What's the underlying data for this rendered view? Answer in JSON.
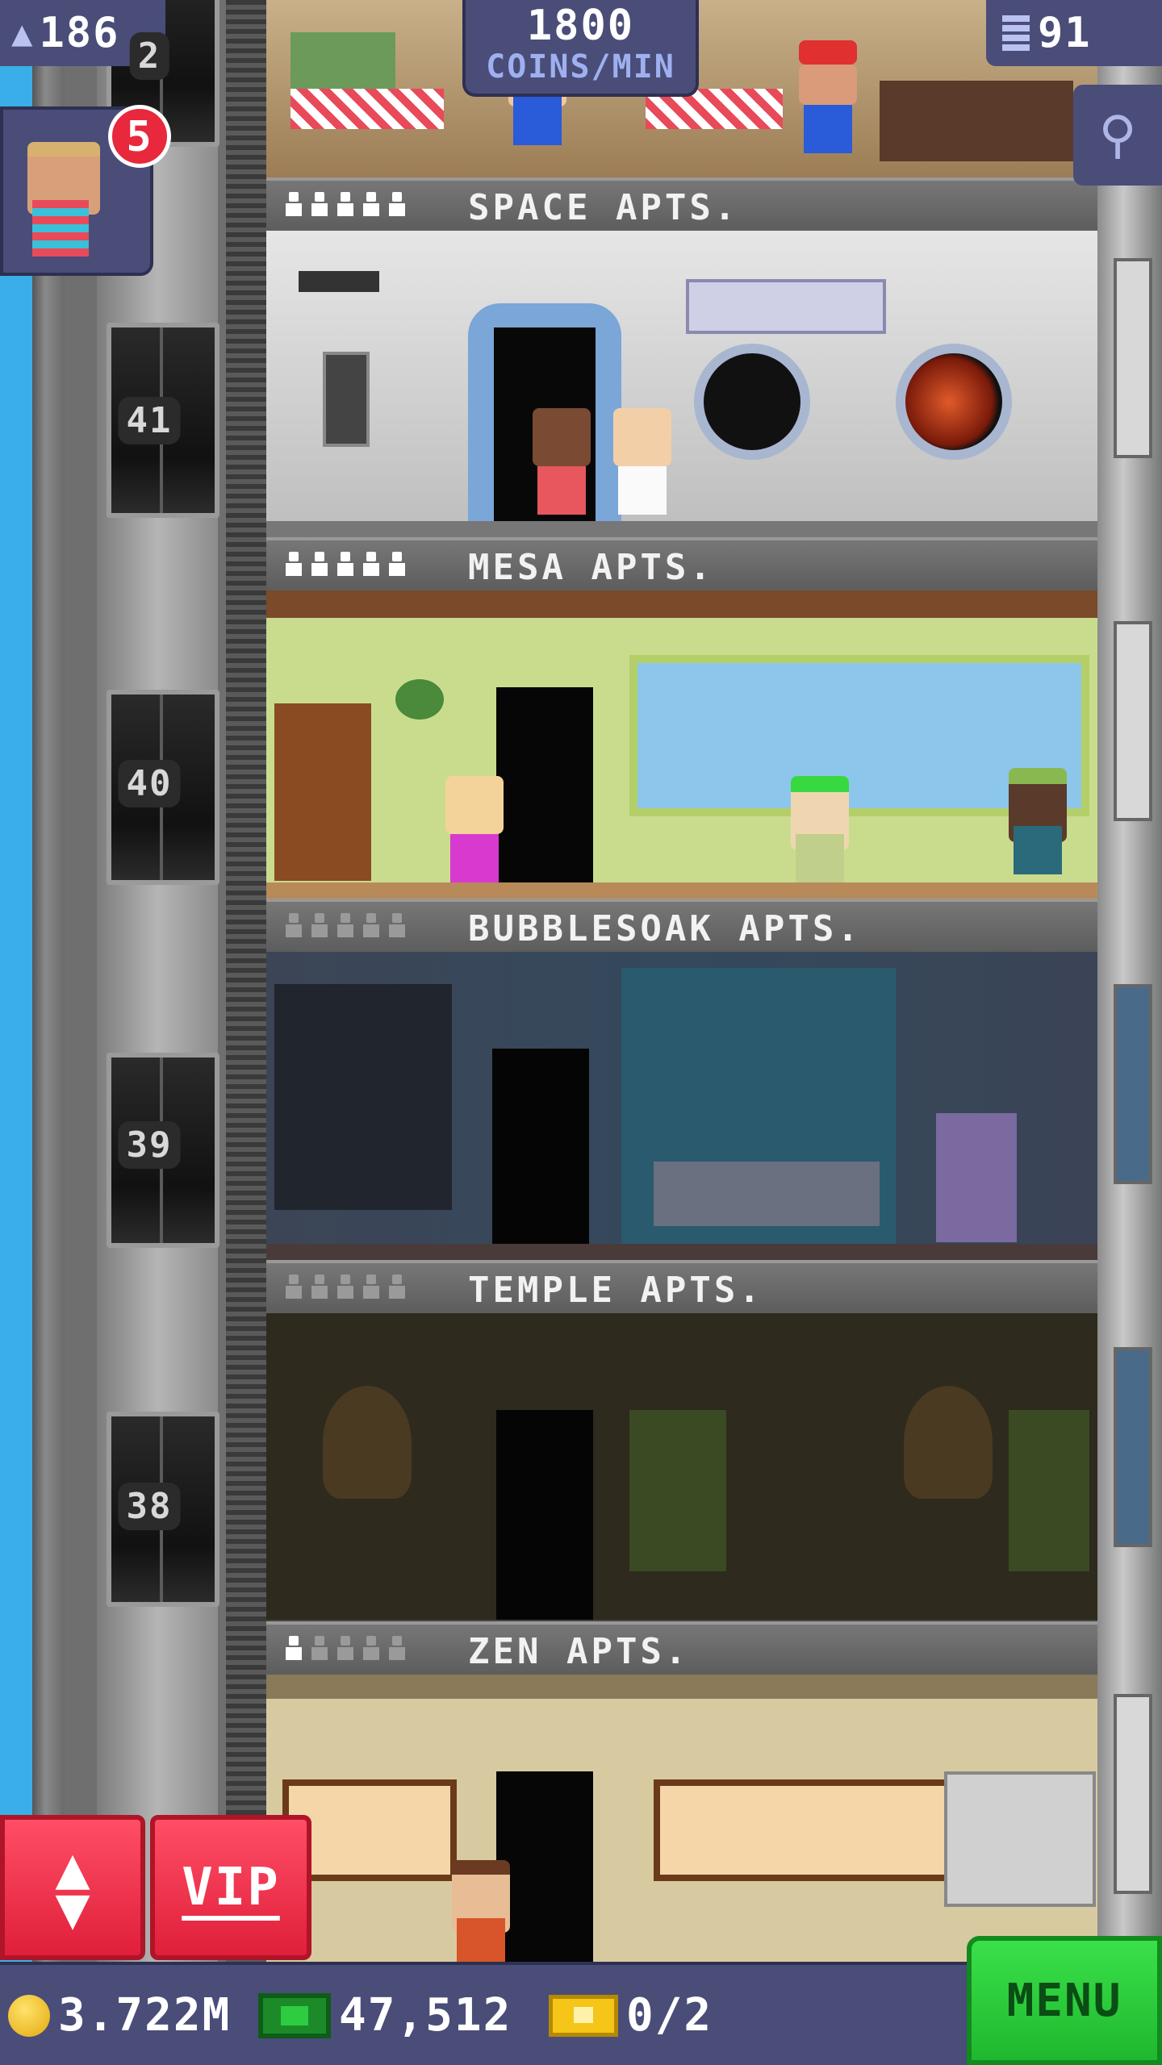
{
  "hud": {
    "population": "186",
    "rate_value": "1800",
    "rate_unit": "COINS/MIN",
    "floor_count": "91"
  },
  "visitor": {
    "badge_count": "5"
  },
  "elevator": {
    "floor_numbers": [
      "41",
      "40",
      "39",
      "38"
    ],
    "partial_top_number": "2"
  },
  "floors": [
    {
      "name": "SPACE APTS.",
      "stars_filled": 5
    },
    {
      "name": "MESA APTS.",
      "stars_filled": 5
    },
    {
      "name": "BUBBLESOAK APTS.",
      "stars_filled": 0
    },
    {
      "name": "TEMPLE APTS.",
      "stars_filled": 0
    },
    {
      "name": "ZEN APTS.",
      "stars_filled": 1
    }
  ],
  "buttons": {
    "elevator_icon": "up-down-arrows-icon",
    "vip_label": "VIP",
    "menu_label": "MENU"
  },
  "bottom": {
    "coins": "3.722M",
    "tower_bux": "47,512",
    "tickets": "0/2"
  },
  "colors": {
    "hud_bg": "#4a4d78",
    "red_button": "#e01f3a",
    "menu_green": "#2ecc40",
    "star_filled": "#ffffff",
    "star_empty": "#9a9a9a"
  }
}
